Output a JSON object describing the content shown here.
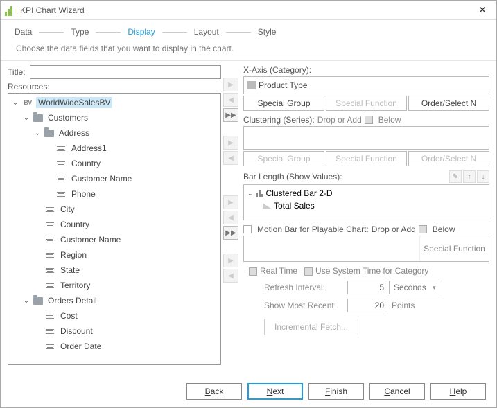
{
  "window": {
    "title": "KPI Chart Wizard"
  },
  "steps": {
    "data": "Data",
    "type": "Type",
    "display": "Display",
    "layout": "Layout",
    "style": "Style"
  },
  "subtitle": "Choose the data fields that you want to display in the chart.",
  "left": {
    "title_label": "Title:",
    "title_value": "",
    "resources_label": "Resources:",
    "tree": {
      "root": "WorldWideSalesBV",
      "customers": "Customers",
      "address": "Address",
      "address1": "Address1",
      "country_a": "Country",
      "custname_a": "Customer Name",
      "phone": "Phone",
      "city": "City",
      "country": "Country",
      "custname": "Customer Name",
      "region": "Region",
      "state": "State",
      "territory": "Territory",
      "orders": "Orders Detail",
      "cost": "Cost",
      "discount": "Discount",
      "orderdate": "Order Date"
    }
  },
  "right": {
    "xaxis_label": "X-Axis (Category):",
    "xaxis_item": "Product Type",
    "special_group": "Special Group",
    "special_function": "Special Function",
    "order_select": "Order/Select N",
    "clustering_label": "Clustering (Series):",
    "drop_or_add": "Drop or Add",
    "below": "Below",
    "barlen_label": "Bar Length (Show Values):",
    "clustered_bar": "Clustered Bar 2-D",
    "total_sales": "Total Sales",
    "motion_label": "Motion Bar for Playable Chart:",
    "real_time": "Real Time",
    "use_system": "Use System Time for Category",
    "refresh_label": "Refresh Interval:",
    "refresh_value": "5",
    "refresh_unit": "Seconds",
    "recent_label": "Show Most Recent:",
    "recent_value": "20",
    "recent_unit": "Points",
    "incremental": "Incremental Fetch..."
  },
  "footer": {
    "back": "Back",
    "next": "Next",
    "finish": "Finish",
    "cancel": "Cancel",
    "help": "Help"
  }
}
